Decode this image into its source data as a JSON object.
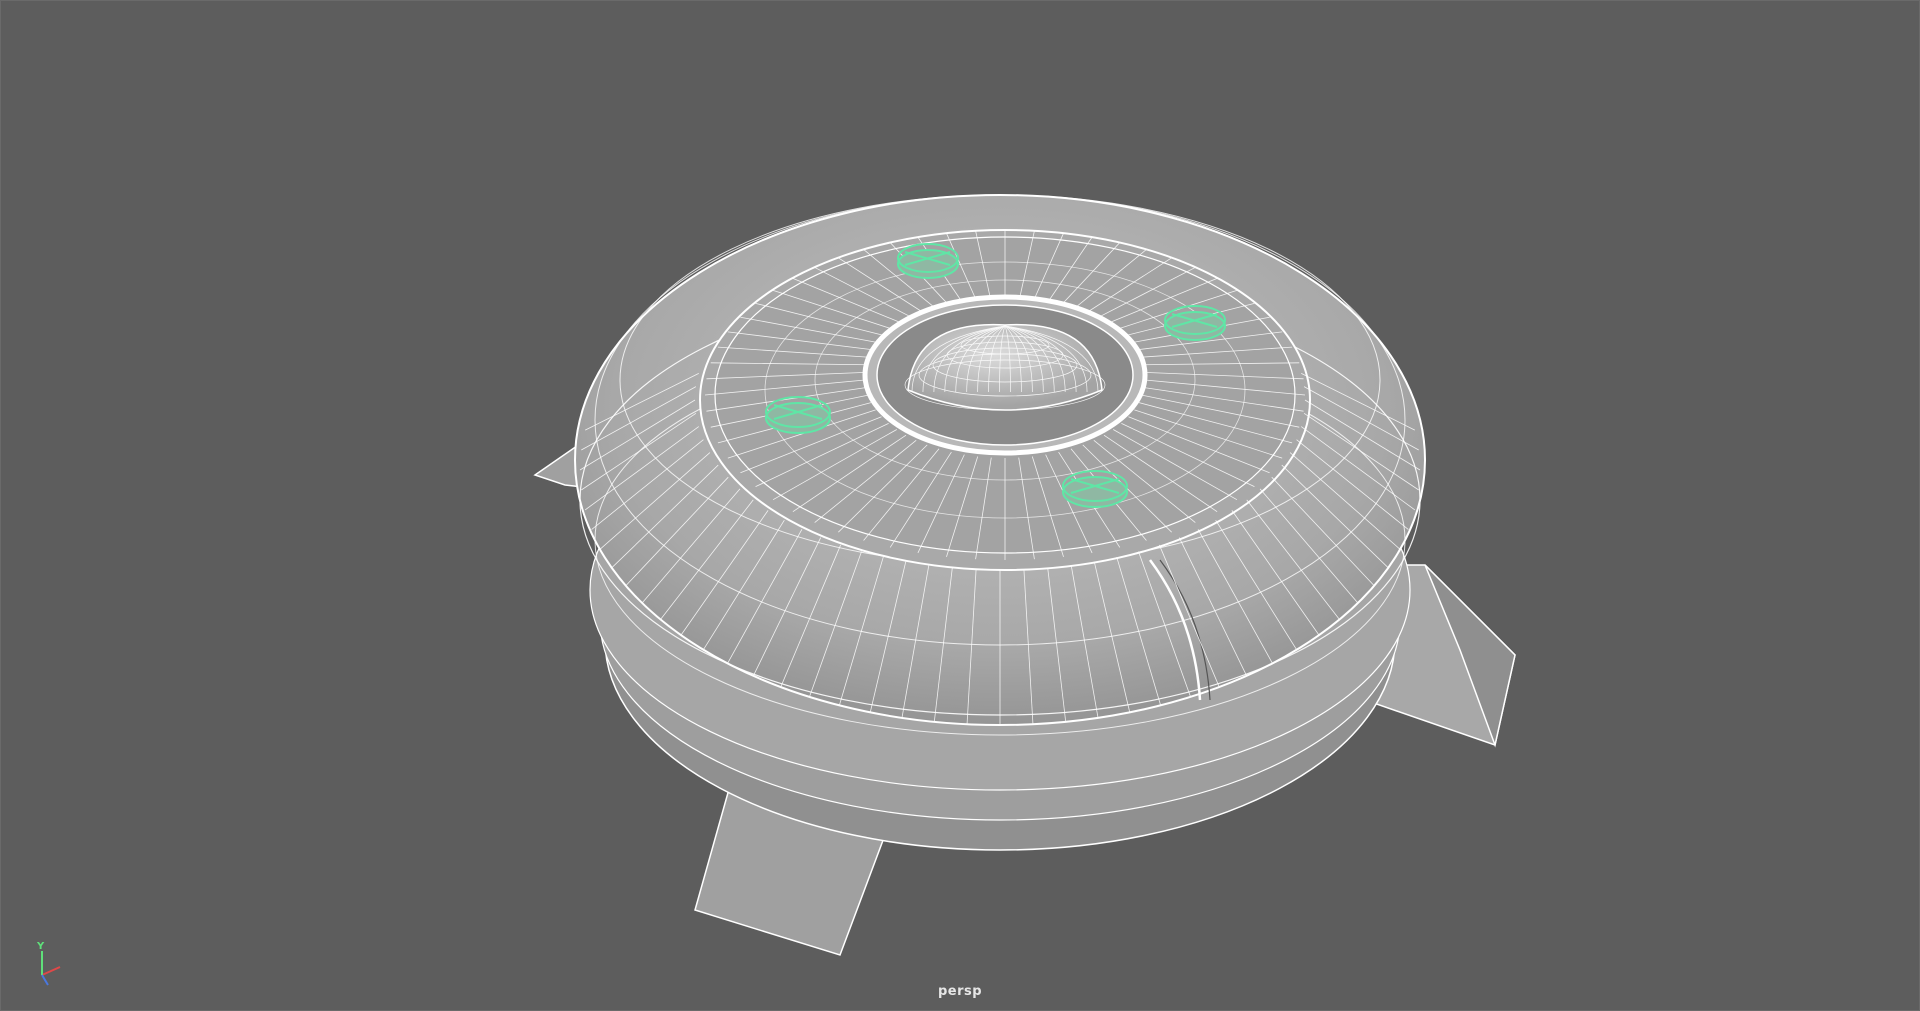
{
  "viewport": {
    "camera_label": "persp",
    "background_color": "#5d5d5d",
    "wire_color": "#ffffff",
    "surface_color": "#9a9a9a",
    "highlight_color": "#5fe6a6"
  },
  "axis_gizmo": {
    "y_label": "Y",
    "x_color": "#e04848",
    "y_color": "#5fe07a",
    "z_color": "#4a78e0"
  }
}
